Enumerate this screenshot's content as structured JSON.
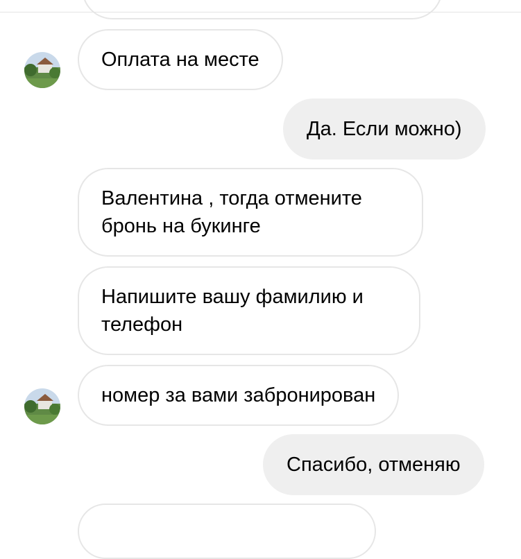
{
  "colors": {
    "incoming_border": "#e6e6e6",
    "outgoing_bg": "#efefef",
    "background": "#ffffff"
  },
  "messages": [
    {
      "direction": "in",
      "text": "Оплата на месте"
    },
    {
      "direction": "out",
      "text": "Да. Если можно)"
    },
    {
      "direction": "in",
      "text": "Валентина , тогда отмените бронь на букинге"
    },
    {
      "direction": "in",
      "text": "Напишите вашу фамилию и телефон"
    },
    {
      "direction": "in",
      "text": "номер за вами забронирован"
    },
    {
      "direction": "out",
      "text": "Спасибо, отменяю"
    }
  ]
}
